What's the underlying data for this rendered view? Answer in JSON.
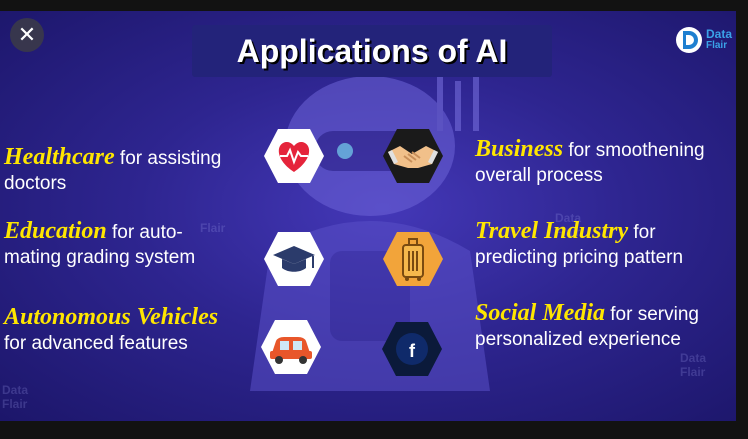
{
  "close_label": "✕",
  "title": "Applications of AI",
  "logo": {
    "line1": "Data",
    "line2": "Flair"
  },
  "watermark": {
    "line1": "Data",
    "line2": "Flair"
  },
  "items": {
    "healthcare": {
      "head": "Healthcare",
      "rest1": " for assisting",
      "rest2": "doctors"
    },
    "education": {
      "head": "Education",
      "rest1": " for auto-",
      "rest2": "mating grading system"
    },
    "vehicles": {
      "head": "Autonomous Vehicles",
      "rest2": "for advanced features"
    },
    "business": {
      "head": "Business",
      "rest1": " for smoothening",
      "rest2": " overall process"
    },
    "travel": {
      "head": "Travel Industry",
      "rest1": " for",
      "rest2": "predicting pricing pattern"
    },
    "social": {
      "head": "Social Media",
      "rest1": " for serving",
      "rest2": "personalized experience"
    }
  },
  "icons": {
    "facebook_letter": "f"
  },
  "colors": {
    "accent_yellow": "#ffe600",
    "background": "#2e2590",
    "title_bg": "#23237a"
  }
}
